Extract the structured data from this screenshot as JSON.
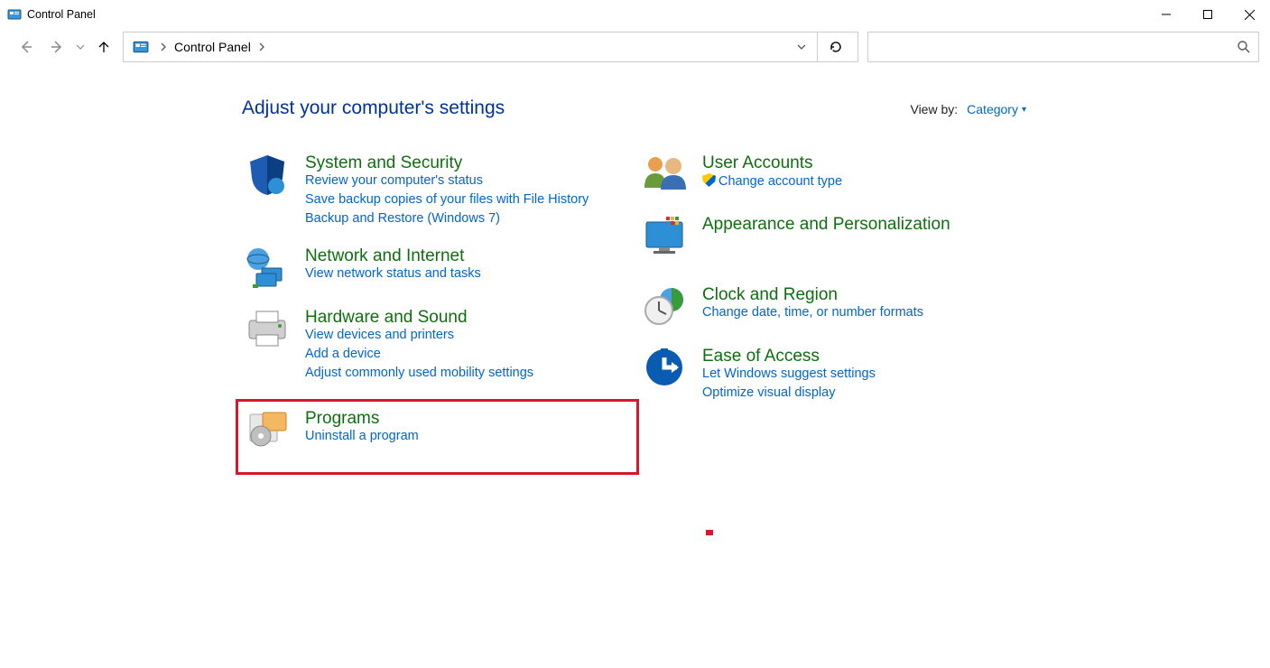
{
  "window": {
    "title": "Control Panel"
  },
  "breadcrumb": {
    "root": "Control Panel"
  },
  "heading": "Adjust your computer's settings",
  "viewby": {
    "label": "View by:",
    "value": "Category"
  },
  "left": {
    "system": {
      "title": "System and Security",
      "links": [
        "Review your computer's status",
        "Save backup copies of your files with File History",
        "Backup and Restore (Windows 7)"
      ]
    },
    "network": {
      "title": "Network and Internet",
      "links": [
        "View network status and tasks"
      ]
    },
    "hardware": {
      "title": "Hardware and Sound",
      "links": [
        "View devices and printers",
        "Add a device",
        "Adjust commonly used mobility settings"
      ]
    },
    "programs": {
      "title": "Programs",
      "links": [
        "Uninstall a program"
      ]
    }
  },
  "right": {
    "users": {
      "title": "User Accounts",
      "links": [
        "Change account type"
      ]
    },
    "appearance": {
      "title": "Appearance and Personalization",
      "links": []
    },
    "clock": {
      "title": "Clock and Region",
      "links": [
        "Change date, time, or number formats"
      ]
    },
    "ease": {
      "title": "Ease of Access",
      "links": [
        "Let Windows suggest settings",
        "Optimize visual display"
      ]
    }
  }
}
